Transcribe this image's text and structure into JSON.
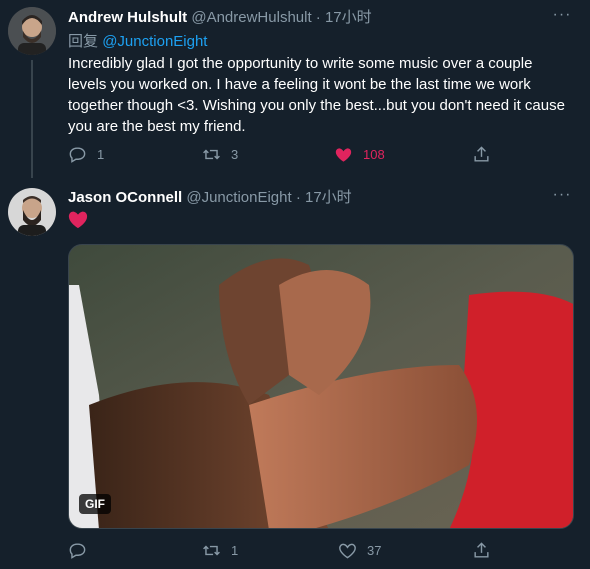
{
  "tweets": [
    {
      "name": "Andrew Hulshult",
      "handle": "@AndrewHulshult",
      "separator": "·",
      "time": "17小时",
      "reply_prefix": "回复",
      "reply_to": "@JunctionEight",
      "text": "Incredibly glad I got the opportunity to write some music over a couple levels you worked on. I have a feeling it wont be the last time we work together though <3. Wishing you only the best...but you don't need it cause you are the best my friend.",
      "replies": "1",
      "retweets": "3",
      "likes": "108",
      "liked": true
    },
    {
      "name": "Jason OConnell",
      "handle": "@JunctionEight",
      "separator": "·",
      "time": "17小时",
      "media_badge": "GIF",
      "replies": "",
      "retweets": "1",
      "likes": "37",
      "liked": false
    }
  ],
  "colors": {
    "background": "#15202b",
    "secondary_text": "#8899a6",
    "link": "#1da1f2",
    "like": "#e0245e",
    "border": "#38444d"
  },
  "icons": [
    "reply-icon",
    "retweet-icon",
    "heart-icon",
    "share-icon",
    "more-icon",
    "red-heart-emoji"
  ]
}
